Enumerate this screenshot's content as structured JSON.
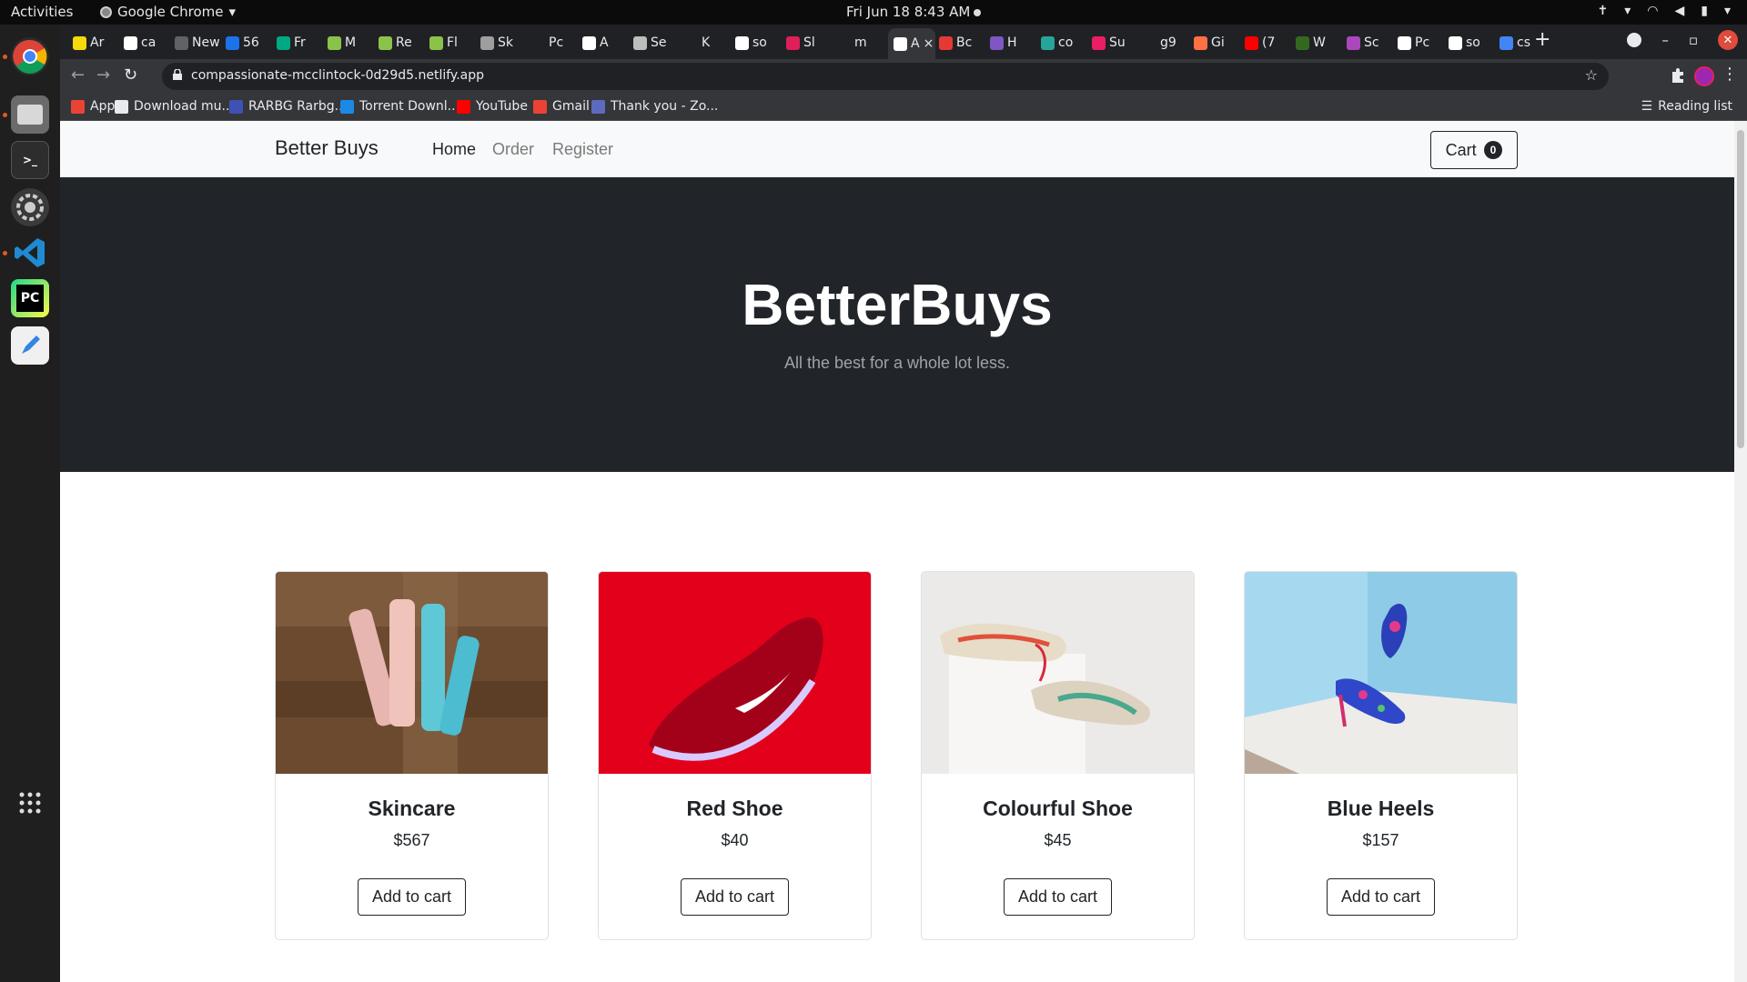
{
  "system_bar": {
    "activities": "Activities",
    "app_name": "Google Chrome",
    "clock": "Fri Jun 18  8:43 AM"
  },
  "browser": {
    "tabs": [
      {
        "label": "Ar",
        "color": "#f5d90a"
      },
      {
        "label": "ca",
        "color": "#ffffff"
      },
      {
        "label": "New",
        "color": "#5f6368"
      },
      {
        "label": "56",
        "color": "#1a73e8"
      },
      {
        "label": "Fr",
        "color": "#00a884"
      },
      {
        "label": "M",
        "color": "#8bc34a"
      },
      {
        "label": "Re",
        "color": "#8bc34a"
      },
      {
        "label": "Fl",
        "color": "#8bc34a"
      },
      {
        "label": "Sk",
        "color": "#9e9e9e"
      },
      {
        "label": "Pc",
        "color": "#202124"
      },
      {
        "label": "A",
        "color": "#ffffff"
      },
      {
        "label": "Se",
        "color": "#bdbdbd"
      },
      {
        "label": "K",
        "color": "#202124"
      },
      {
        "label": "so",
        "color": "#ffffff"
      },
      {
        "label": "Sl",
        "color": "#e01e5a"
      },
      {
        "label": "m",
        "color": "#202124"
      },
      {
        "label": "A",
        "color": "#ffffff"
      },
      {
        "label": "Bc",
        "color": "#e53935"
      },
      {
        "label": "H",
        "color": "#7e57c2"
      },
      {
        "label": "co",
        "color": "#26a69a"
      },
      {
        "label": "Su",
        "color": "#e91e63"
      },
      {
        "label": "g9",
        "color": "#202124"
      },
      {
        "label": "Gi",
        "color": "#ff7043"
      },
      {
        "label": "(7",
        "color": "#ff0000"
      },
      {
        "label": "W",
        "color": "#33691e"
      },
      {
        "label": "Sc",
        "color": "#ab47bc"
      },
      {
        "label": "Pc",
        "color": "#ffffff"
      },
      {
        "label": "so",
        "color": "#ffffff"
      },
      {
        "label": "cs",
        "color": "#4285f4"
      }
    ],
    "new_tab": "+",
    "url": "compassionate-mcclintock-0d29d5.netlify.app",
    "bookmarks": [
      {
        "label": "Apps",
        "color": "#ea4335"
      },
      {
        "label": "Download mu...",
        "color": "#e8eaed"
      },
      {
        "label": "RARBG Rarbg...",
        "color": "#3f51b5"
      },
      {
        "label": "Torrent Downl...",
        "color": "#1e88e5"
      },
      {
        "label": "YouTube",
        "color": "#ff0000"
      },
      {
        "label": "Gmail",
        "color": "#ea4335"
      },
      {
        "label": "Thank you - Zo...",
        "color": "#5c6bc0"
      }
    ],
    "reading_list": "Reading list"
  },
  "site": {
    "brand": "Better Buys",
    "nav": [
      {
        "label": "Home",
        "active": true
      },
      {
        "label": "Order",
        "active": false
      },
      {
        "label": "Register",
        "active": false
      }
    ],
    "cart_label": "Cart",
    "cart_count": "0",
    "hero_title": "BetterBuys",
    "hero_subtitle": "All the best for a whole lot less.",
    "products": [
      {
        "name": "Skincare",
        "price": "$567",
        "button": "Add to cart"
      },
      {
        "name": "Red Shoe",
        "price": "$40",
        "button": "Add to cart"
      },
      {
        "name": "Colourful Shoe",
        "price": "$45",
        "button": "Add to cart"
      },
      {
        "name": "Blue Heels",
        "price": "$157",
        "button": "Add to cart"
      }
    ]
  },
  "colors": {
    "hero_bg": "#212529",
    "nav_bg": "#f8f9fa",
    "red_shoe_bg": "#e3001b",
    "blue_heels_bg": "#8ecbe6"
  }
}
